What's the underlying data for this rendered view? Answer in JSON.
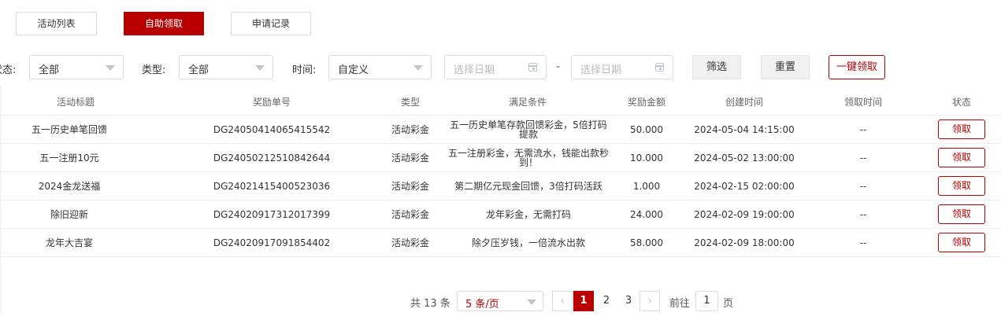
{
  "tabs": [
    {
      "label": "活动列表",
      "active": false
    },
    {
      "label": "自助领取",
      "active": true
    },
    {
      "label": "申请记录",
      "active": false
    }
  ],
  "filters": {
    "status_label": "状态:",
    "status_value": "全部",
    "type_label": "类型:",
    "type_value": "全部",
    "time_label": "时间:",
    "time_value": "自定义",
    "start_placeholder": "选择日期",
    "separator": "-",
    "end_placeholder": "选择日期",
    "filter_button": "筛选",
    "reset_button": "重置",
    "claim_all_button": "一键领取"
  },
  "table": {
    "headers": [
      "活动标题",
      "奖励单号",
      "类型",
      "满足条件",
      "奖励金额",
      "创建时间",
      "领取时间",
      "状态"
    ],
    "rows": [
      {
        "title": "五一历史单笔回馈",
        "order": "DG24050414065415542",
        "type": "活动彩金",
        "condition": "五一历史单笔存款回馈彩金，5倍打码提款",
        "amount": "50.000",
        "created": "2024-05-04 14:15:00",
        "claimed": "--",
        "action": "领取"
      },
      {
        "title": "五一注册10元",
        "order": "DG24050212510842644",
        "type": "活动彩金",
        "condition": "五一注册彩金，无需流水，钱能出款秒到！",
        "amount": "10.000",
        "created": "2024-05-02 13:00:00",
        "claimed": "--",
        "action": "领取"
      },
      {
        "title": "2024金龙送福",
        "order": "DG24021415400523036",
        "type": "活动彩金",
        "condition": "第二期亿元现金回馈，3倍打码活跃",
        "amount": "1.000",
        "created": "2024-02-15 02:00:00",
        "claimed": "--",
        "action": "领取"
      },
      {
        "title": "除旧迎新",
        "order": "DG24020917312017399",
        "type": "活动彩金",
        "condition": "龙年彩金，无需打码",
        "amount": "24.000",
        "created": "2024-02-09 19:00:00",
        "claimed": "--",
        "action": "领取"
      },
      {
        "title": "龙年大吉宴",
        "order": "DG24020917091854402",
        "type": "活动彩金",
        "condition": "除夕压岁钱，一倍流水出款",
        "amount": "58.000",
        "created": "2024-02-09 18:00:00",
        "claimed": "--",
        "action": "领取"
      }
    ]
  },
  "pagination": {
    "total_text": "共 13 条",
    "page_size": "5 条/页",
    "prev_icon": "‹",
    "next_icon": "›",
    "pages": [
      "1",
      "2",
      "3"
    ],
    "current_page": "1",
    "goto_label": "前往",
    "goto_value": "1",
    "goto_suffix": "页"
  },
  "colors": {
    "accent": "#b80000"
  }
}
